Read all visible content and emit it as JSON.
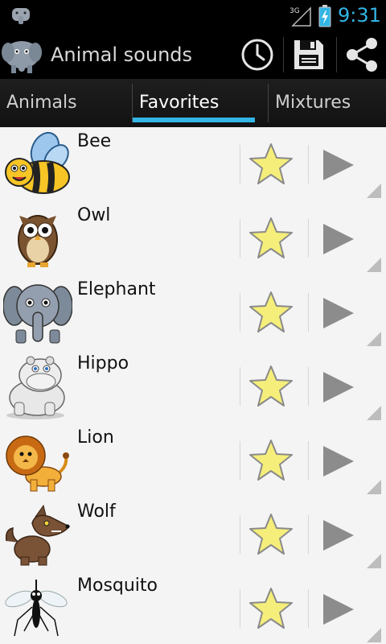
{
  "status_bar": {
    "time": "9:31",
    "network": "3G",
    "icons": [
      "elephant-notification-icon",
      "signal-icon",
      "battery-icon"
    ],
    "time_color": "#33b5e5"
  },
  "action_bar": {
    "title": "Animal sounds",
    "icons": [
      "app-logo-elephant-icon",
      "clock-icon",
      "save-icon",
      "share-icon"
    ]
  },
  "tabs": [
    {
      "label": "Animals",
      "active": false
    },
    {
      "label": "Favorites",
      "active": true
    },
    {
      "label": "Mixtures",
      "active": false
    }
  ],
  "accent_color": "#33b5e5",
  "list": {
    "items": [
      {
        "name": "Bee",
        "icon": "bee-icon"
      },
      {
        "name": "Owl",
        "icon": "owl-icon"
      },
      {
        "name": "Elephant",
        "icon": "elephant-icon"
      },
      {
        "name": "Hippo",
        "icon": "hippo-icon"
      },
      {
        "name": "Lion",
        "icon": "lion-icon"
      },
      {
        "name": "Wolf",
        "icon": "wolf-icon"
      },
      {
        "name": "Mosquito",
        "icon": "mosquito-icon"
      }
    ],
    "favorite_icon": "star-icon",
    "favorite_color": "#f5ee7a",
    "play_icon": "play-icon"
  }
}
